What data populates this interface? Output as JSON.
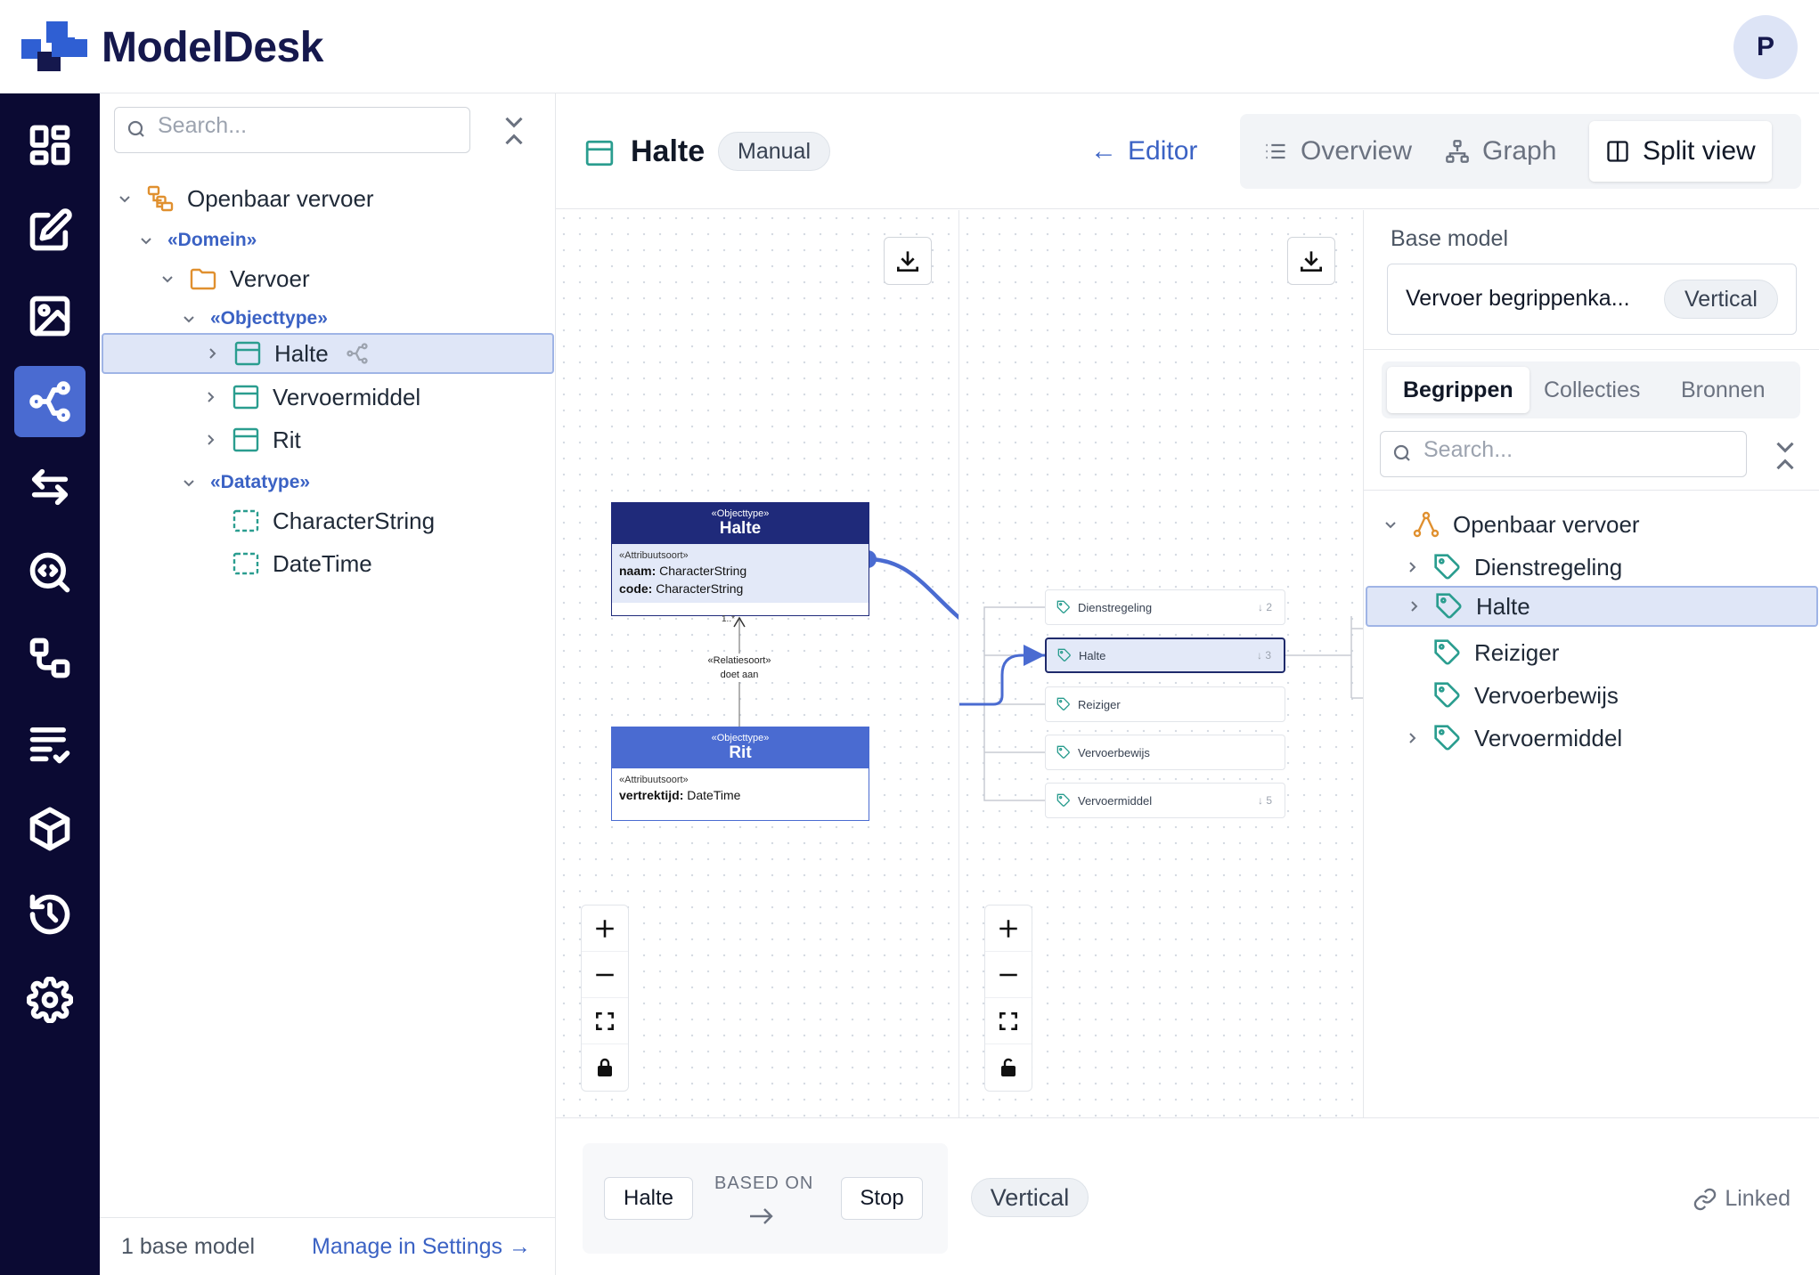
{
  "app": {
    "name": "ModelDesk",
    "avatar_initial": "P"
  },
  "rail": {
    "icons": [
      "dashboard-icon",
      "edit-icon",
      "image-icon",
      "graph-icon",
      "compare-arrows-icon",
      "code-search-icon",
      "mapping-icon",
      "checklist-icon",
      "package-icon",
      "history-icon",
      "settings-icon"
    ],
    "active": "graph-icon"
  },
  "tree": {
    "search_placeholder": "Search...",
    "items": [
      {
        "label": "Openbaar vervoer",
        "kind": "package"
      },
      {
        "label": "«Domein»",
        "kind": "stereotype"
      },
      {
        "label": "Vervoer",
        "kind": "folder"
      },
      {
        "label": "«Objecttype»",
        "kind": "stereotype"
      },
      {
        "label": "Halte",
        "kind": "class",
        "selected": true
      },
      {
        "label": "Vervoermiddel",
        "kind": "class"
      },
      {
        "label": "Rit",
        "kind": "class"
      },
      {
        "label": "«Datatype»",
        "kind": "stereotype"
      },
      {
        "label": "CharacterString",
        "kind": "datatype"
      },
      {
        "label": "DateTime",
        "kind": "datatype"
      }
    ],
    "footer_count": "1 base model",
    "footer_link": "Manage in Settings"
  },
  "header": {
    "title": "Halte",
    "badge": "Manual",
    "editor_link": "Editor",
    "tabs": [
      {
        "label": "Overview",
        "icon": "list-icon"
      },
      {
        "label": "Graph",
        "icon": "hierarchy-icon"
      },
      {
        "label": "Split view",
        "icon": "split-icon",
        "active": true
      }
    ]
  },
  "uml": {
    "halte": {
      "stereotype": "«Objecttype»",
      "name": "Halte",
      "attr_stereotype": "«Attribuutsoort»",
      "attributes": [
        {
          "name": "naam:",
          "type": " CharacterString"
        },
        {
          "name": "code:",
          "type": " CharacterString"
        }
      ],
      "header_color": "#1f2a7a"
    },
    "rit": {
      "stereotype": "«Objecttype»",
      "name": "Rit",
      "attr_stereotype": "«Attribuutsoort»",
      "attributes": [
        {
          "name": "vertrektijd:",
          "type": " DateTime"
        }
      ],
      "header_color": "#4a6bd1"
    },
    "relation": {
      "stereotype": "«Relatiesoort»",
      "name": "doet aan",
      "multiplicity": "1..*"
    }
  },
  "graph_nodes": [
    {
      "label": "Dienstregeling",
      "count": "↓ 2"
    },
    {
      "label": "Halte",
      "count": "↓ 3",
      "selected": true
    },
    {
      "label": "Reiziger",
      "count": ""
    },
    {
      "label": "Vervoerbewijs",
      "count": ""
    },
    {
      "label": "Vervoermiddel",
      "count": "↓ 5"
    }
  ],
  "right_panel": {
    "base_model_label": "Base model",
    "model_name": "Vervoer begrippenka...",
    "model_badge": "Vertical",
    "tabs": [
      {
        "label": "Begrippen",
        "active": true
      },
      {
        "label": "Collecties"
      },
      {
        "label": "Bronnen"
      }
    ],
    "search_placeholder": "Search...",
    "tree": [
      {
        "label": "Openbaar vervoer",
        "kind": "root"
      },
      {
        "label": "Dienstregeling",
        "expandable": true
      },
      {
        "label": "Halte",
        "expandable": true,
        "selected": true
      },
      {
        "label": "Reiziger"
      },
      {
        "label": "Vervoerbewijs"
      },
      {
        "label": "Vervoermiddel",
        "expandable": true
      }
    ]
  },
  "bottom": {
    "source": "Halte",
    "relation": "BASED ON",
    "target": "Stop",
    "badge": "Vertical",
    "status": "Linked"
  },
  "colors": {
    "brand": "#15184d",
    "accent": "#4a6bd1",
    "rail": "#0b0a33",
    "teal": "#2a9d8f",
    "orange": "#e0902f"
  }
}
